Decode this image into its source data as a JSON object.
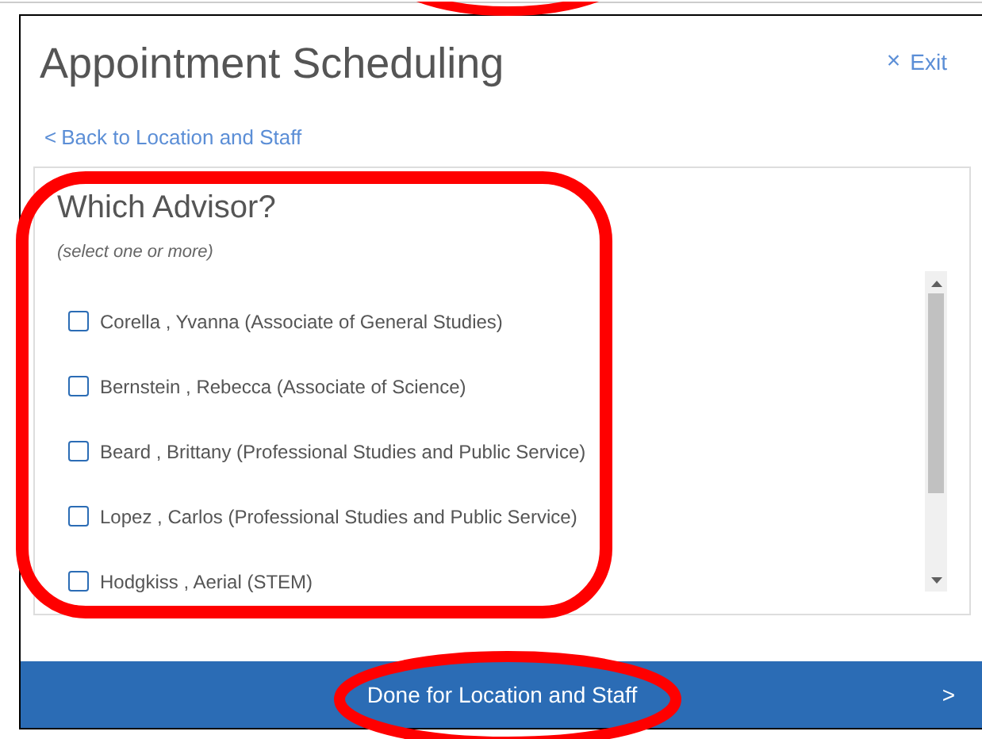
{
  "dialog": {
    "title": "Appointment Scheduling",
    "exit": {
      "icon": "×",
      "label": "Exit"
    },
    "back_link": {
      "icon": "<",
      "label": "Back to Location and Staff"
    }
  },
  "advisor_panel": {
    "heading": "Which Advisor?",
    "hint": "(select one or more)",
    "options": [
      {
        "label": "Corella , Yvanna (Associate of General Studies)",
        "checked": false
      },
      {
        "label": "Bernstein , Rebecca (Associate of Science)",
        "checked": false
      },
      {
        "label": "Beard , Brittany (Professional Studies and Public Service)",
        "checked": false
      },
      {
        "label": "Lopez , Carlos (Professional Studies and Public Service)",
        "checked": false
      },
      {
        "label": "Hodgkiss , Aerial (STEM)",
        "checked": false
      }
    ]
  },
  "footer_button": {
    "label": "Done for Location and Staff",
    "icon": ">"
  }
}
